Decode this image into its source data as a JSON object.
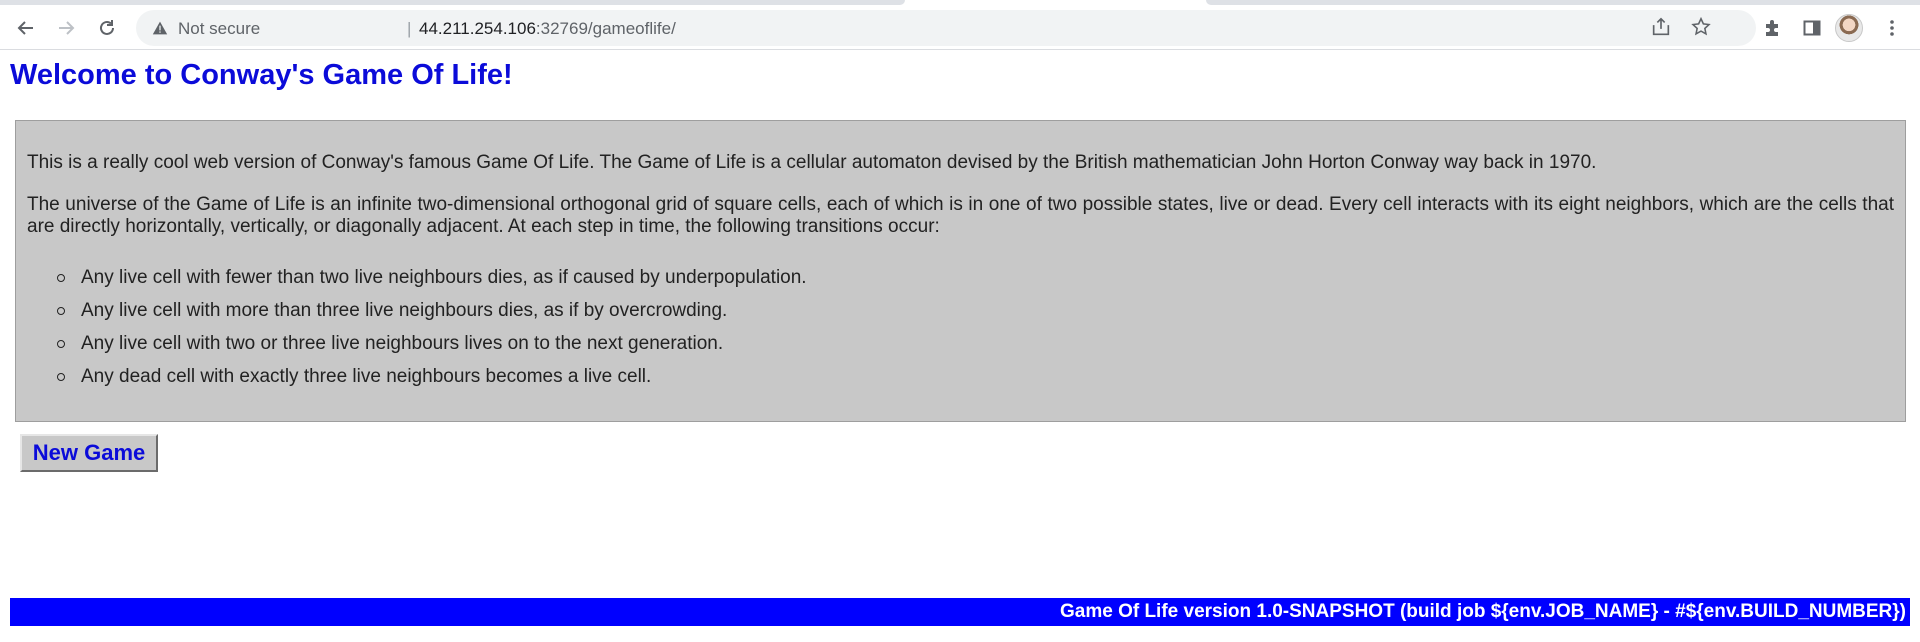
{
  "browser": {
    "security_label": "Not secure",
    "separator": "|",
    "url_host": "44.211.254.106",
    "url_rest": ":32769/gameoflife/",
    "icons": [
      "back-icon",
      "forward-icon",
      "reload-icon",
      "warning-icon",
      "share-icon",
      "star-icon",
      "extensions-icon",
      "side-panel-icon",
      "profile-avatar",
      "menu-icon"
    ]
  },
  "page": {
    "title": "Welcome to Conway's Game Of Life!",
    "intro": "This is a really cool web version of Conway's famous Game Of Life. The Game of Life is a cellular automaton devised by the British mathematician John Horton Conway way back in 1970.",
    "description": "The universe of the Game of Life is an infinite two-dimensional orthogonal grid of square cells, each of which is in one of two possible states, live or dead. Every cell interacts with its eight neighbors, which are the cells that are directly horizontally, vertically, or diagonally adjacent. At each step in time, the following transitions occur:",
    "rules": [
      "Any live cell with fewer than two live neighbours dies, as if caused by underpopulation.",
      "Any live cell with more than three live neighbours dies, as if by overcrowding.",
      "Any live cell with two or three live neighbours lives on to the next generation.",
      "Any dead cell with exactly three live neighbours becomes a live cell."
    ],
    "new_game_label": "New Game",
    "footer": "Game Of Life version 1.0-SNAPSHOT (build job ${env.JOB_NAME} - #${env.BUILD_NUMBER})"
  },
  "colors": {
    "title": "#0b0bd9",
    "info_bg": "#c8c8c8",
    "footer_bg": "#0000ff",
    "footer_text": "#ffffff"
  }
}
